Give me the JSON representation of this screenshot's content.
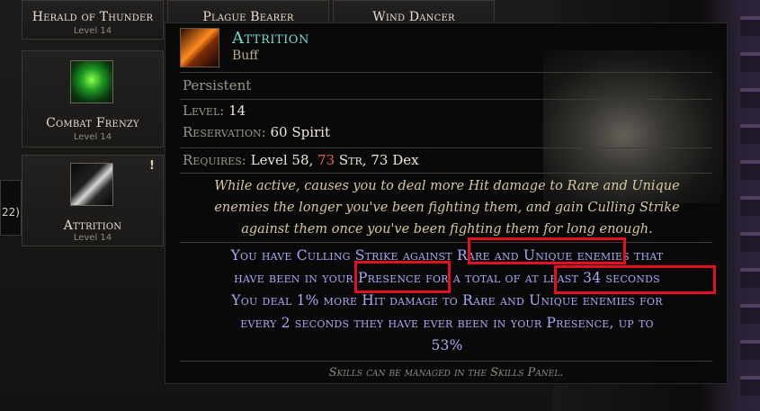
{
  "left_strip_label": "22)",
  "skills": [
    {
      "name": "Herald of Thunder",
      "level": "Level 14"
    },
    {
      "name": "Plague Bearer",
      "level": ""
    },
    {
      "name": "Wind Dancer",
      "level": ""
    },
    {
      "name": "Combat Frenzy",
      "level": "Level 14"
    },
    {
      "name": "Attrition",
      "level": "Level 14"
    }
  ],
  "skill_icons": [
    "combat-frenzy-icon",
    "attrition-icon"
  ],
  "tooltip": {
    "title": "Attrition",
    "type": "Buff",
    "tag": "Persistent",
    "level_label": "Level:",
    "level_value": "14",
    "reservation_label": "Reservation:",
    "reservation_value": "60 Spirit",
    "requires_label": "Requires:",
    "requires_level": "Level 58,",
    "requires_str_value": "73",
    "requires_str_label": "Str,",
    "requires_dex": "73 Dex",
    "description_lines": [
      "While active, causes you to deal more Hit damage to Rare and Unique",
      "enemies the longer you've been fighting them, and gain Culling Strike",
      "against them once you've been fighting them for long enough."
    ],
    "modifier_lines": [
      "You have Culling Strike against Rare and Unique enemies that",
      "have been in your Presence for a total of at least 34 seconds",
      "You deal 1% more Hit damage to Rare and Unique enemies for",
      "every 2 seconds they have ever been in your Presence, up to",
      "53%"
    ],
    "footer": "Skills can be managed in the Skills Panel."
  },
  "colors": {
    "title": "#78d8cf",
    "modifier": "#a9a9f4",
    "description": "#d6c79e",
    "highlight": "#e3101f",
    "strength_value": "#e06050"
  }
}
